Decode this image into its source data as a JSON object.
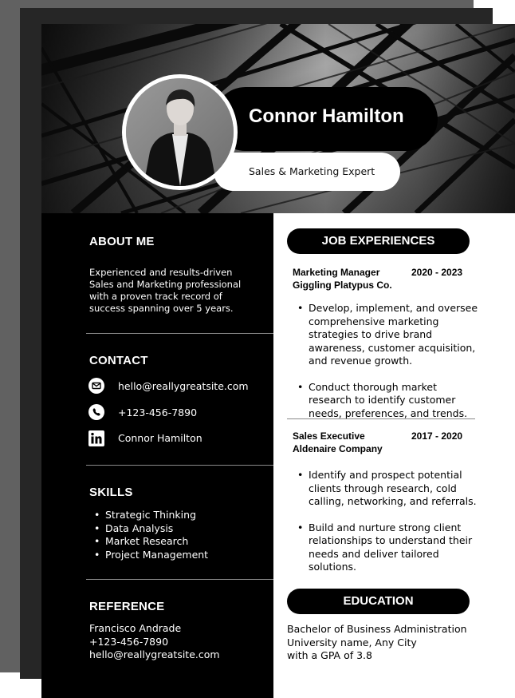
{
  "header": {
    "name": "Connor Hamilton",
    "title": "Sales & Marketing Expert"
  },
  "about": {
    "heading": "ABOUT ME",
    "lines": [
      "Experienced and results-driven",
      "Sales and Marketing professional",
      "with a proven track record of",
      "success spanning over 5 years."
    ]
  },
  "contact": {
    "heading": "CONTACT",
    "email": "hello@reallygreatsite.com",
    "phone": "+123-456-7890",
    "linkedin": "Connor Hamilton"
  },
  "skills": {
    "heading": "SKILLS",
    "items": [
      "Strategic Thinking",
      "Data Analysis",
      "Market Research",
      "Project Management"
    ]
  },
  "reference": {
    "heading": "REFERENCE",
    "name": "Francisco Andrade",
    "phone": "+123-456-7890",
    "email": "hello@reallygreatsite.com"
  },
  "experience": {
    "heading": "JOB EXPERIENCES",
    "jobs": [
      {
        "role": "Marketing Manager",
        "company": "Giggling Platypus Co.",
        "dates": "2020 - 2023",
        "bullets": [
          "Develop, implement, and oversee comprehensive marketing strategies to drive brand awareness, customer acquisition, and revenue growth.",
          "Conduct thorough market research to identify customer needs, preferences, and trends."
        ]
      },
      {
        "role": "Sales Executive",
        "company": "Aldenaire Company",
        "dates": "2017 - 2020",
        "bullets": [
          "Identify and prospect potential clients through research, cold calling, networking, and referrals.",
          "Build and nurture strong client relationships to understand their needs and deliver tailored solutions."
        ]
      }
    ]
  },
  "education": {
    "heading": "EDUCATION",
    "lines": [
      "Bachelor of Business Administration",
      "University name, Any City",
      "with a GPA of 3.8"
    ]
  },
  "icons": {
    "email": "envelope-icon",
    "phone": "phone-icon",
    "linkedin": "linkedin-icon"
  }
}
